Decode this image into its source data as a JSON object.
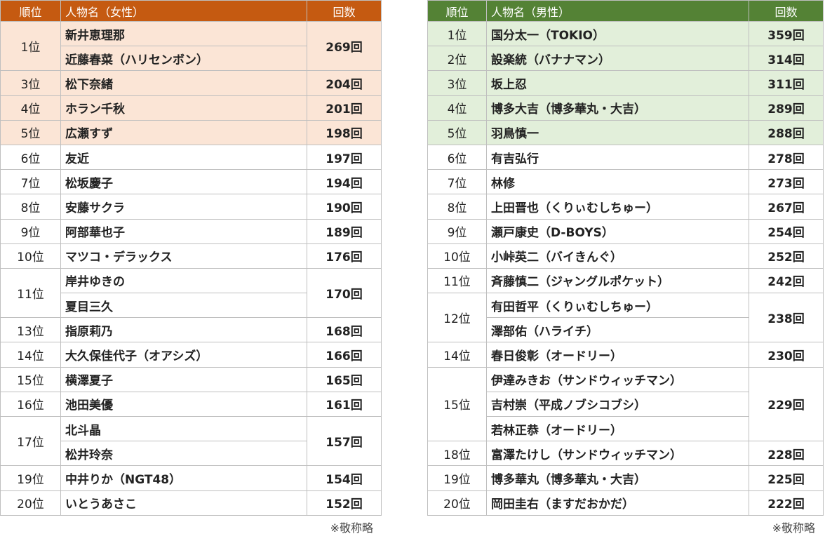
{
  "female": {
    "headers": {
      "rank": "順位",
      "name": "人物名（女性）",
      "count": "回数"
    },
    "note": "※敬称略",
    "groups": [
      {
        "rank": "1位",
        "names": [
          "新井恵理那",
          "近藤春菜（ハリセンボン）"
        ],
        "count": "269回",
        "highlight": true
      },
      {
        "rank": "3位",
        "names": [
          "松下奈緒"
        ],
        "count": "204回",
        "highlight": true
      },
      {
        "rank": "4位",
        "names": [
          "ホラン千秋"
        ],
        "count": "201回",
        "highlight": true
      },
      {
        "rank": "5位",
        "names": [
          "広瀬すず"
        ],
        "count": "198回",
        "highlight": true
      },
      {
        "rank": "6位",
        "names": [
          "友近"
        ],
        "count": "197回",
        "highlight": false
      },
      {
        "rank": "7位",
        "names": [
          "松坂慶子"
        ],
        "count": "194回",
        "highlight": false
      },
      {
        "rank": "8位",
        "names": [
          "安藤サクラ"
        ],
        "count": "190回",
        "highlight": false
      },
      {
        "rank": "9位",
        "names": [
          "阿部華也子"
        ],
        "count": "189回",
        "highlight": false
      },
      {
        "rank": "10位",
        "names": [
          "マツコ・デラックス"
        ],
        "count": "176回",
        "highlight": false
      },
      {
        "rank": "11位",
        "names": [
          "岸井ゆきの",
          "夏目三久"
        ],
        "count": "170回",
        "highlight": false
      },
      {
        "rank": "13位",
        "names": [
          "指原莉乃"
        ],
        "count": "168回",
        "highlight": false
      },
      {
        "rank": "14位",
        "names": [
          "大久保佳代子（オアシズ）"
        ],
        "count": "166回",
        "highlight": false
      },
      {
        "rank": "15位",
        "names": [
          "横澤夏子"
        ],
        "count": "165回",
        "highlight": false
      },
      {
        "rank": "16位",
        "names": [
          "池田美優"
        ],
        "count": "161回",
        "highlight": false
      },
      {
        "rank": "17位",
        "names": [
          "北斗晶",
          "松井玲奈"
        ],
        "count": "157回",
        "highlight": false
      },
      {
        "rank": "19位",
        "names": [
          "中井りか（NGT48）"
        ],
        "count": "154回",
        "highlight": false
      },
      {
        "rank": "20位",
        "names": [
          "いとうあさこ"
        ],
        "count": "152回",
        "highlight": false
      }
    ]
  },
  "male": {
    "headers": {
      "rank": "順位",
      "name": "人物名（男性）",
      "count": "回数"
    },
    "note": "※敬称略",
    "groups": [
      {
        "rank": "1位",
        "names": [
          "国分太一（TOKIO）"
        ],
        "count": "359回",
        "highlight": true
      },
      {
        "rank": "2位",
        "names": [
          "設楽統（バナナマン）"
        ],
        "count": "314回",
        "highlight": true
      },
      {
        "rank": "3位",
        "names": [
          "坂上忍"
        ],
        "count": "311回",
        "highlight": true
      },
      {
        "rank": "4位",
        "names": [
          "博多大吉（博多華丸・大吉）"
        ],
        "count": "289回",
        "highlight": true
      },
      {
        "rank": "5位",
        "names": [
          "羽鳥慎一"
        ],
        "count": "288回",
        "highlight": true
      },
      {
        "rank": "6位",
        "names": [
          "有吉弘行"
        ],
        "count": "278回",
        "highlight": false
      },
      {
        "rank": "7位",
        "names": [
          "林修"
        ],
        "count": "273回",
        "highlight": false
      },
      {
        "rank": "8位",
        "names": [
          "上田晋也（くりぃむしちゅー）"
        ],
        "count": "267回",
        "highlight": false
      },
      {
        "rank": "9位",
        "names": [
          "瀬戸康史（D-BOYS）"
        ],
        "count": "254回",
        "highlight": false
      },
      {
        "rank": "10位",
        "names": [
          "小峠英二（バイきんぐ）"
        ],
        "count": "252回",
        "highlight": false
      },
      {
        "rank": "11位",
        "names": [
          "斉藤慎二（ジャングルポケット）"
        ],
        "count": "242回",
        "highlight": false
      },
      {
        "rank": "12位",
        "names": [
          "有田哲平（くりぃむしちゅー）",
          "澤部佑（ハライチ）"
        ],
        "count": "238回",
        "highlight": false
      },
      {
        "rank": "14位",
        "names": [
          "春日俊彰（オードリー）"
        ],
        "count": "230回",
        "highlight": false
      },
      {
        "rank": "15位",
        "names": [
          "伊達みきお（サンドウィッチマン）",
          "吉村崇（平成ノブシコブシ）",
          "若林正恭（オードリー）"
        ],
        "count": "229回",
        "highlight": false
      },
      {
        "rank": "18位",
        "names": [
          "富澤たけし（サンドウィッチマン）"
        ],
        "count": "228回",
        "highlight": false
      },
      {
        "rank": "19位",
        "names": [
          "博多華丸（博多華丸・大吉）"
        ],
        "count": "225回",
        "highlight": false
      },
      {
        "rank": "20位",
        "names": [
          "岡田圭右（ますだおかだ）"
        ],
        "count": "222回",
        "highlight": false
      }
    ]
  }
}
